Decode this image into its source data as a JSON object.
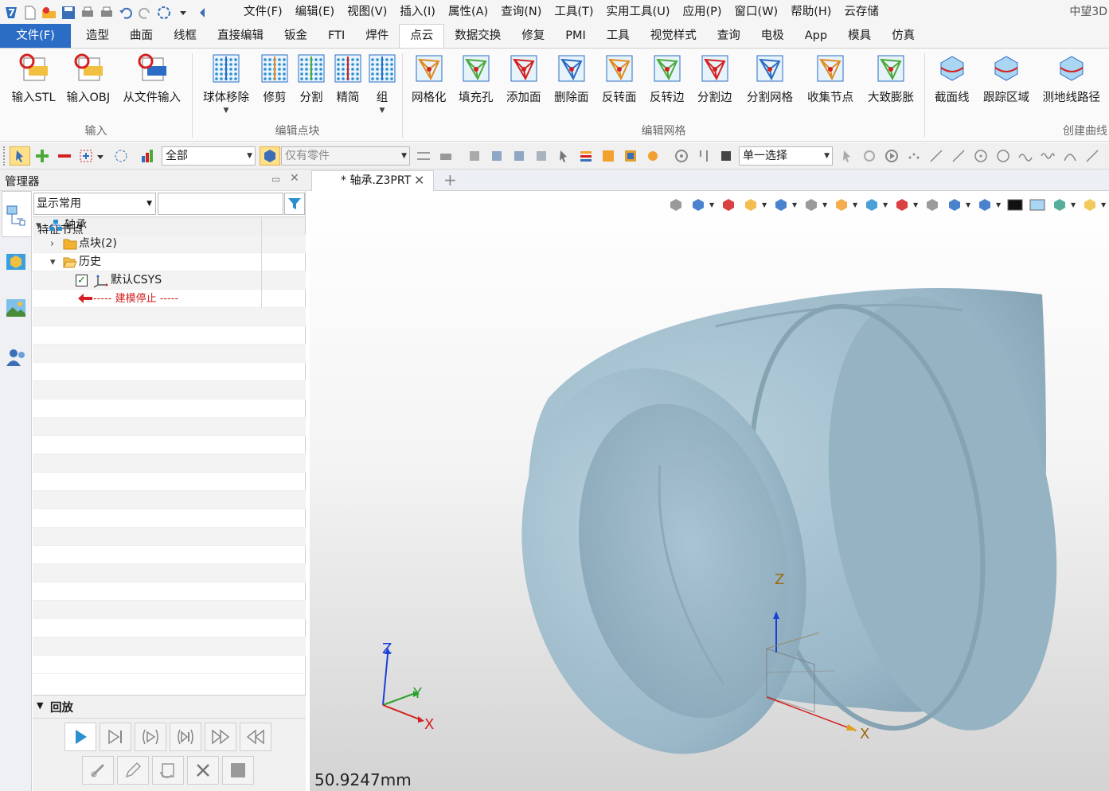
{
  "app": {
    "brand": "中望3D"
  },
  "menus": [
    "文件(F)",
    "编辑(E)",
    "视图(V)",
    "插入(I)",
    "属性(A)",
    "查询(N)",
    "工具(T)",
    "实用工具(U)",
    "应用(P)",
    "窗口(W)",
    "帮助(H)",
    "云存储"
  ],
  "ribbon_tabs": [
    "文件(F)",
    "造型",
    "曲面",
    "线框",
    "直接编辑",
    "钣金",
    "FTI",
    "焊件",
    "点云",
    "数据交换",
    "修复",
    "PMI",
    "工具",
    "视觉样式",
    "查询",
    "电极",
    "App",
    "模具",
    "仿真"
  ],
  "active_tab": "点云",
  "ribbon": {
    "groups": [
      {
        "label": "输入",
        "buttons": [
          "输入STL",
          "输入OBJ",
          "从文件输入"
        ]
      },
      {
        "label": "编辑点块",
        "buttons": [
          "球体移除",
          "修剪",
          "分割",
          "精简",
          "组"
        ]
      },
      {
        "label": "编辑网格",
        "buttons": [
          "网格化",
          "填充孔",
          "添加面",
          "删除面",
          "反转面",
          "反转边",
          "分割边",
          "分割网格",
          "收集节点",
          "大致膨胀"
        ]
      },
      {
        "label": "创建曲线",
        "buttons": [
          "截面线",
          "跟踪区域",
          "测地线路径"
        ]
      }
    ]
  },
  "toolbar2": {
    "filter_value": "全部",
    "scope_value": "仅有零件",
    "select_mode": "单一选择"
  },
  "manager": {
    "title": "管理器",
    "display_filter": "显示常用",
    "search_value": "",
    "column_header": "特征节点",
    "tree": [
      {
        "label": "轴承",
        "level": 0,
        "expand": "▾",
        "icon": "assembly-icon"
      },
      {
        "label": "点块(2)",
        "level": 1,
        "expand": "›",
        "icon": "folder-icon"
      },
      {
        "label": "历史",
        "level": 1,
        "expand": "▾",
        "icon": "folder-open-icon"
      },
      {
        "label": "默认CSYS",
        "level": 2,
        "expand": "",
        "icon": "csys-icon",
        "checked": true
      },
      {
        "label": "----- 建模停止 -----",
        "level": 2,
        "expand": "",
        "icon": "stop-arrow-icon",
        "stop": true
      }
    ],
    "replay_title": "回放"
  },
  "document": {
    "tab_label": "* 轴承.Z3PRT"
  },
  "viewport": {
    "measure": "50.9247mm",
    "axis_labels": {
      "x": "X",
      "y": "Y",
      "z": "Z"
    }
  },
  "colors": {
    "accent": "#2b6cc4",
    "model": "#9fbccb",
    "stop": "#d42020"
  }
}
